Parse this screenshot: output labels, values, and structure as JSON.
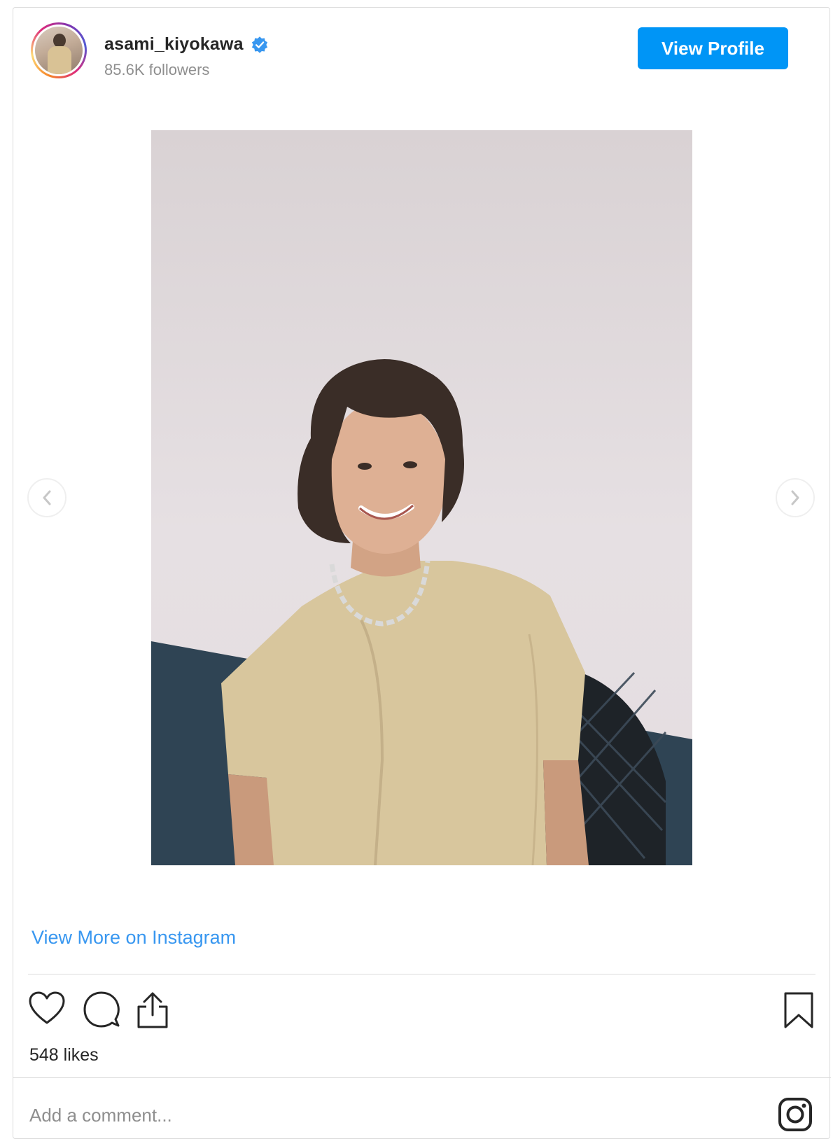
{
  "header": {
    "username": "asami_kiyokawa",
    "verified": true,
    "followers": "85.6K followers",
    "view_profile_label": "View Profile"
  },
  "post": {
    "image_alt": "",
    "view_more_label": "View More on Instagram",
    "likes": "548 likes"
  },
  "actions": {
    "like_icon": "heart-icon",
    "comment_icon": "comment-bubble-icon",
    "share_icon": "share-icon",
    "save_icon": "bookmark-icon"
  },
  "comment": {
    "placeholder": "Add a comment..."
  },
  "colors": {
    "accent": "#0095f6",
    "link": "#3897f0",
    "text": "#262626",
    "muted": "#8e8e8e",
    "border": "#dbdbdb"
  }
}
